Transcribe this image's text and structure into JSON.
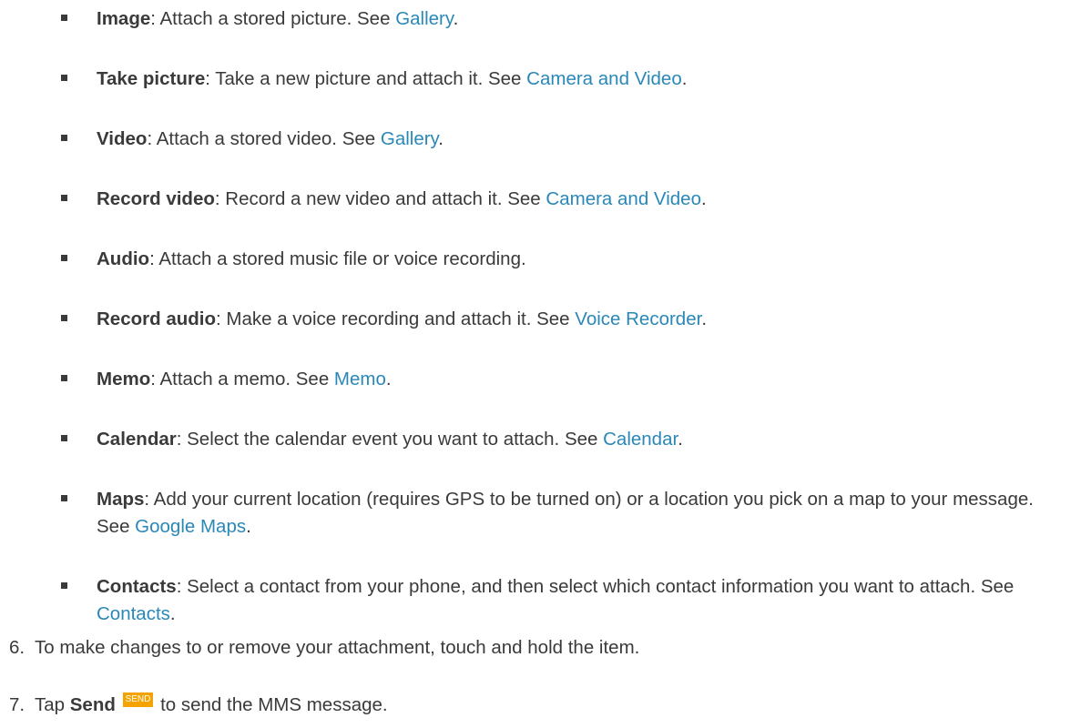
{
  "bullets": [
    {
      "term": "Image",
      "text": ": Attach a stored picture. See ",
      "link": "Gallery",
      "end": "."
    },
    {
      "term": "Take picture",
      "text": ": Take a new picture and attach it. See ",
      "link": "Camera and Video",
      "end": "."
    },
    {
      "term": "Video",
      "text": ": Attach a stored video. See ",
      "link": "Gallery",
      "end": "."
    },
    {
      "term": "Record video",
      "text": ": Record a new video and attach it. See ",
      "link": "Camera and Video",
      "end": "."
    },
    {
      "term": "Audio",
      "text": ": Attach a stored music file or voice recording.",
      "link": "",
      "end": ""
    },
    {
      "term": "Record audio",
      "text": ": Make a voice recording and attach it. See ",
      "link": "Voice Recorder",
      "end": "."
    },
    {
      "term": "Memo",
      "text": ": Attach a memo. See ",
      "link": "Memo",
      "end": "."
    },
    {
      "term": "Calendar",
      "text": ": Select the calendar event you want to attach. See ",
      "link": "Calendar",
      "end": "."
    },
    {
      "term": "Maps",
      "text": ": Add your current location (requires GPS to be turned on) or a location you pick on a map to your message. See ",
      "link": "Google Maps",
      "end": "."
    },
    {
      "term": "Contacts",
      "text": ": Select a contact from your phone, and then select which contact information you want to attach. See ",
      "link": "Contacts",
      "end": "."
    }
  ],
  "steps": [
    {
      "number": "6.",
      "text": "To make changes to or remove your attachment, touch and hold the item."
    },
    {
      "number": "7.",
      "pre": "Tap ",
      "bold": "Send",
      "badge": "SEND",
      "post": " to send the MMS message."
    }
  ]
}
